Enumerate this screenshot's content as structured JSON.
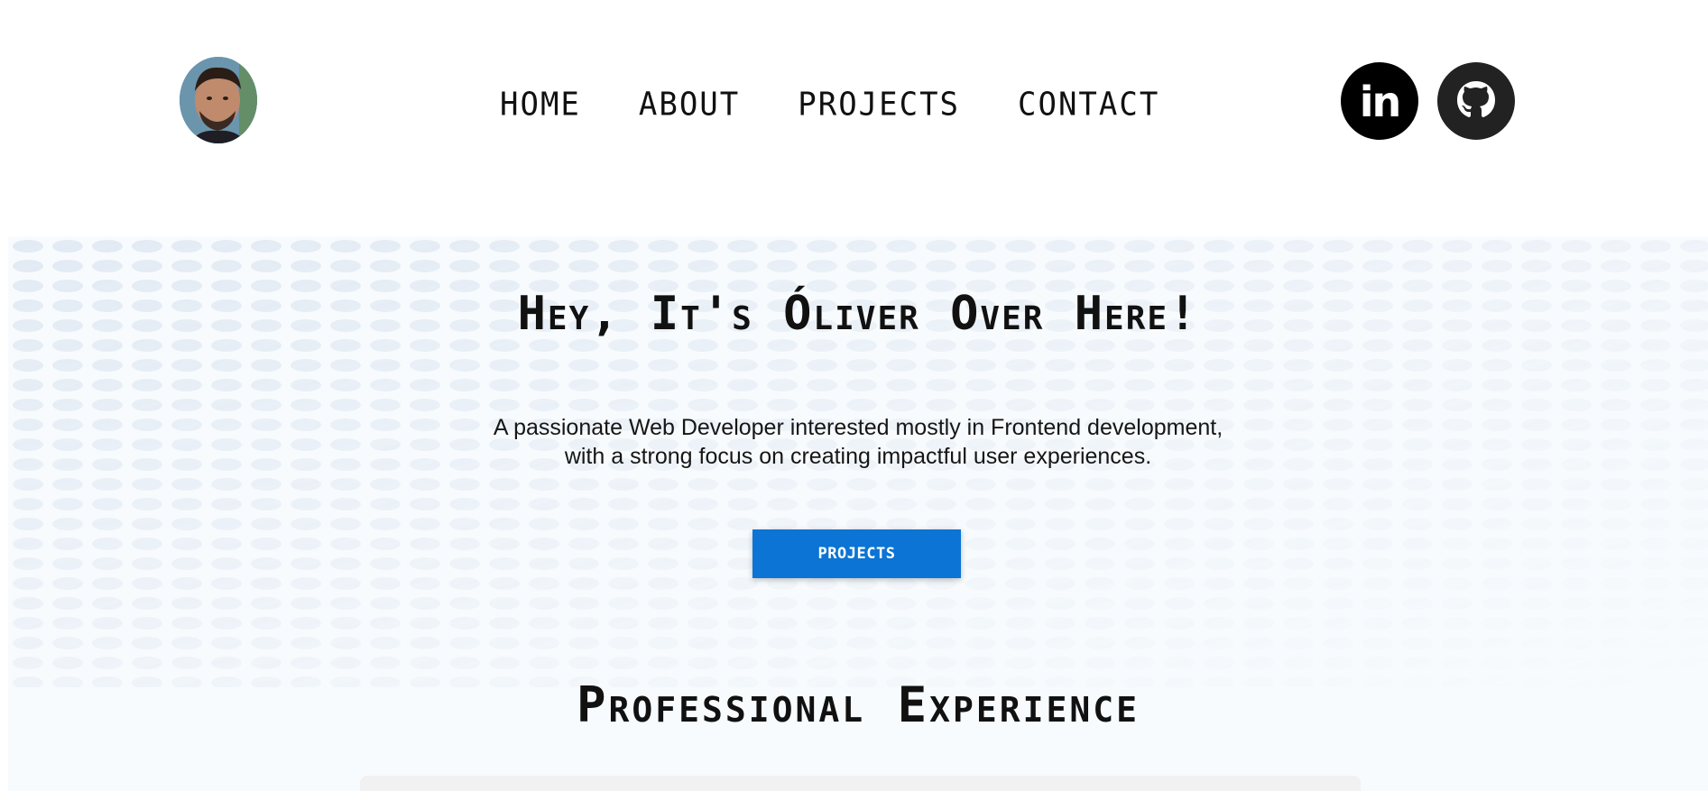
{
  "header": {
    "avatar_alt": "Profile photo",
    "nav": [
      {
        "label": "HOME"
      },
      {
        "label": "ABOUT"
      },
      {
        "label": "PROJECTS"
      },
      {
        "label": "CONTACT"
      }
    ],
    "social": {
      "linkedin_label": "in",
      "linkedin_icon": "linkedin-icon",
      "github_icon": "github-icon"
    }
  },
  "hero": {
    "title": "Hey, It's Óliver Over Here!",
    "description_line1": "A passionate Web Developer interested mostly in Frontend development,",
    "description_line2": "with a strong focus on creating impactful user experiences.",
    "cta_label": "PROJECTS"
  },
  "experience": {
    "title": "Professional Experience"
  },
  "colors": {
    "accent": "#0b74d4",
    "hero_background": "#f8fbfd",
    "text": "#111111"
  }
}
